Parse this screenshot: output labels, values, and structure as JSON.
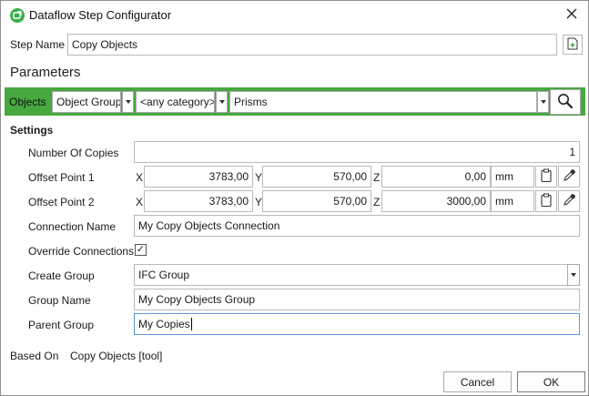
{
  "window": {
    "title": "Dataflow Step Configurator",
    "close_glyph": "✕"
  },
  "step": {
    "label": "Step Name",
    "value": "Copy Objects"
  },
  "parameters": {
    "heading": "Parameters",
    "objects_label": "Objects",
    "object_type": "Object Group",
    "category": "<any category>",
    "filter_value": "Prisms"
  },
  "settings": {
    "heading": "Settings",
    "number_of_copies": {
      "label": "Number Of Copies",
      "value": "1"
    },
    "offset_point_1": {
      "label": "Offset Point 1",
      "x_label": "X",
      "x": "3783,00",
      "y_label": "Y",
      "y": "570,00",
      "z_label": "Z",
      "z": "0,00",
      "unit": "mm"
    },
    "offset_point_2": {
      "label": "Offset Point 2",
      "x_label": "X",
      "x": "3783,00",
      "y_label": "Y",
      "y": "570,00",
      "z_label": "Z",
      "z": "3000,00",
      "unit": "mm"
    },
    "connection_name": {
      "label": "Connection Name",
      "value": "My Copy Objects Connection"
    },
    "override_connections": {
      "label": "Override Connections",
      "checked": true,
      "check_glyph": "✓"
    },
    "create_group": {
      "label": "Create Group",
      "value": "IFC Group"
    },
    "group_name": {
      "label": "Group Name",
      "value": "My Copy Objects Group"
    },
    "parent_group": {
      "label": "Parent Group",
      "value": "My Copies"
    }
  },
  "based_on": {
    "label": "Based On",
    "value": "Copy Objects [tool]"
  },
  "buttons": {
    "cancel": "Cancel",
    "ok": "OK"
  },
  "icons": {
    "app": "dataflow-app-icon",
    "new_step": "add-document-icon",
    "search": "magnifier-icon",
    "clipboard": "clipboard-icon",
    "picker": "eyedropper-icon"
  },
  "colors": {
    "accent_green": "#46a83f",
    "focus_blue": "#5b9bd5"
  }
}
